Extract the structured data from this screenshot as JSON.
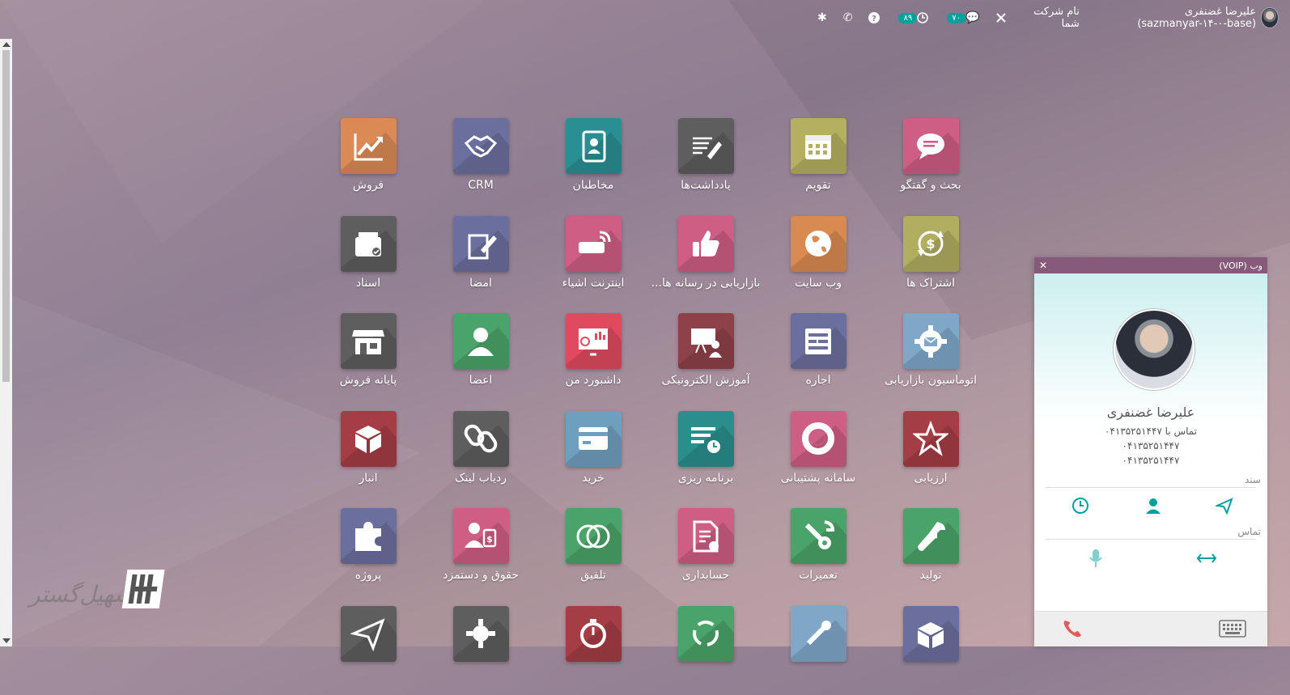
{
  "topbar": {
    "user_label": "علیرضا غضنفری (sazmanyar-۱۴-۰-base)",
    "company_label": "نام شرکت شما",
    "messages_count": "۷۰",
    "activities_count": "۸۹",
    "icons": [
      "settings-tools-icon",
      "chat-icon",
      "clock-icon",
      "help-icon",
      "phone-icon",
      "bug-icon"
    ]
  },
  "apps": [
    {
      "label": "بحث و گفتگو",
      "icon": "chat-bubble-icon",
      "color": "#cf5e84"
    },
    {
      "label": "تقویم",
      "icon": "calendar-icon",
      "color": "#b4b05f"
    },
    {
      "label": "یادداشت‌ها",
      "icon": "notes-icon",
      "color": "#5e5e5e"
    },
    {
      "label": "مخاطبان",
      "icon": "contacts-icon",
      "color": "#2a8f92"
    },
    {
      "label": "CRM",
      "icon": "handshake-icon",
      "color": "#6b6f9d"
    },
    {
      "label": "فروش",
      "icon": "sales-chart-icon",
      "color": "#db8a55"
    },
    {
      "label": "اشتراک ها",
      "icon": "subscription-icon",
      "color": "#b1ae62"
    },
    {
      "label": "وب سایت",
      "icon": "globe-icon",
      "color": "#d98a50"
    },
    {
      "label": "بازاریابی در رسانه ها...",
      "icon": "thumbs-up-icon",
      "color": "#cf5e84"
    },
    {
      "label": "اینترنت اشیاء",
      "icon": "iot-icon",
      "color": "#cf5e84"
    },
    {
      "label": "امضا",
      "icon": "sign-icon",
      "color": "#6b6f9d"
    },
    {
      "label": "اسناد",
      "icon": "documents-icon",
      "color": "#5e5e5e"
    },
    {
      "label": "اتوماسیون بازاریابی",
      "icon": "gear-mail-icon",
      "color": "#7ea7c8"
    },
    {
      "label": "اجاره",
      "icon": "rental-icon",
      "color": "#6b6f9d"
    },
    {
      "label": "آموزش الکترونیکی",
      "icon": "elearning-icon",
      "color": "#8e4148"
    },
    {
      "label": "داشبورد من",
      "icon": "dashboard-icon",
      "color": "#e04a5f"
    },
    {
      "label": "اعضا",
      "icon": "member-icon",
      "color": "#4aa368"
    },
    {
      "label": "پایانه فروش",
      "icon": "shop-icon",
      "color": "#5e5e5e"
    },
    {
      "label": "ارزیابی",
      "icon": "star-icon",
      "color": "#a53d45"
    },
    {
      "label": "سامانه پشتیبانی",
      "icon": "lifebuoy-icon",
      "color": "#cf5e84"
    },
    {
      "label": "برنامه ریزی",
      "icon": "planning-icon",
      "color": "#2a8f8c"
    },
    {
      "label": "خرید",
      "icon": "card-icon",
      "color": "#6f9fbf"
    },
    {
      "label": "ردیاب لینک",
      "icon": "link-icon",
      "color": "#5e5e5e"
    },
    {
      "label": "انبار",
      "icon": "box-icon",
      "color": "#a53d45"
    },
    {
      "label": "تولید",
      "icon": "wrench-icon",
      "color": "#4aa368"
    },
    {
      "label": "تعمیرات",
      "icon": "repair-icon",
      "color": "#4aa368"
    },
    {
      "label": "حسابداری",
      "icon": "accounting-icon",
      "color": "#cf5e84"
    },
    {
      "label": "تلفیق",
      "icon": "consolidation-icon",
      "color": "#4aa368"
    },
    {
      "label": "حقوق و دستمزد",
      "icon": "payroll-icon",
      "color": "#cf5e84"
    },
    {
      "label": "پروژه",
      "icon": "puzzle-icon",
      "color": "#6b6f9d"
    },
    {
      "label": "",
      "icon": "box-open-icon",
      "color": "#6b6f9d"
    },
    {
      "label": "",
      "icon": "tools-icon",
      "color": "#7ea7c8"
    },
    {
      "label": "",
      "icon": "recycle-icon",
      "color": "#4aa368"
    },
    {
      "label": "",
      "icon": "stopwatch-icon",
      "color": "#a53d45"
    },
    {
      "label": "",
      "icon": "gear-icon",
      "color": "#5e5e5e"
    },
    {
      "label": "",
      "icon": "send-icon",
      "color": "#5e5e5e"
    }
  ],
  "voip": {
    "title": "وب (VOIP)",
    "contact_name": "علیرضا غضنفری",
    "call_with": "تماس با ۰۴۱۳۵۲۵۱۴۴۷",
    "phone_1": "۰۴۱۳۵۲۵۱۴۴۷",
    "phone_2": "۰۴۱۳۵۲۵۱۴۴۷",
    "section_document": "سند",
    "section_call": "تماس"
  },
  "colors": {
    "accent": "#00a09d",
    "voip_header": "#875a7b",
    "call_red": "#e25a5a"
  }
}
